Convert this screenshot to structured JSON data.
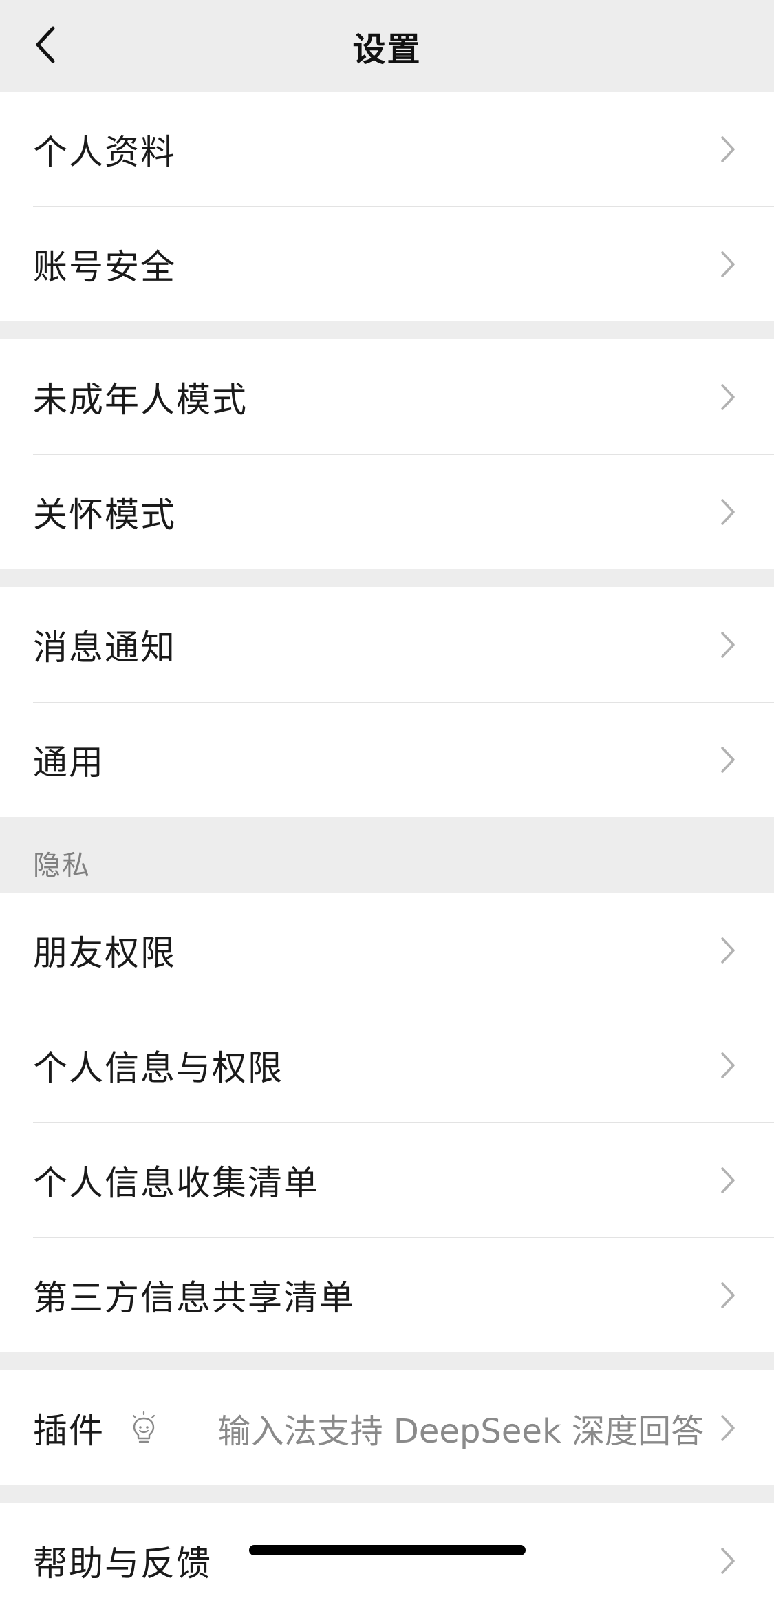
{
  "header": {
    "title": "设置"
  },
  "groups": [
    {
      "items": [
        {
          "label": "个人资料"
        },
        {
          "label": "账号安全"
        }
      ]
    },
    {
      "items": [
        {
          "label": "未成年人模式"
        },
        {
          "label": "关怀模式"
        }
      ]
    },
    {
      "items": [
        {
          "label": "消息通知"
        },
        {
          "label": "通用"
        }
      ]
    },
    {
      "section_title": "隐私",
      "items": [
        {
          "label": "朋友权限"
        },
        {
          "label": "个人信息与权限"
        },
        {
          "label": "个人信息收集清单"
        },
        {
          "label": "第三方信息共享清单"
        }
      ]
    },
    {
      "items": [
        {
          "label": "插件",
          "icon": "lightbulb-icon",
          "value": "输入法支持 DeepSeek 深度回答"
        }
      ]
    },
    {
      "items": [
        {
          "label": "帮助与反馈"
        }
      ]
    }
  ],
  "colors": {
    "background": "#ededed",
    "card": "#ffffff",
    "text": "#1a1a1a",
    "secondary_text": "#8a8a8a",
    "chevron": "#b2b2b2"
  }
}
